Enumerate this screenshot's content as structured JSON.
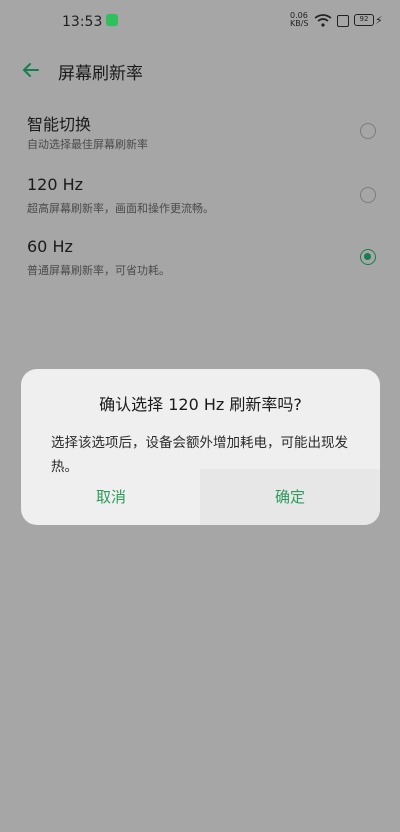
{
  "status_bar": {
    "time": "13:53",
    "net_speed": "0.06 KB/S",
    "battery": "92"
  },
  "header": {
    "title": "屏幕刷新率"
  },
  "options": [
    {
      "label": "智能切换",
      "desc": "自动选择最佳屏幕刷新率",
      "selected": false
    },
    {
      "label": "120 Hz",
      "desc": "超高屏幕刷新率，画面和操作更流畅。",
      "selected": false
    },
    {
      "label": "60 Hz",
      "desc": "普通屏幕刷新率，可省功耗。",
      "selected": true
    }
  ],
  "dialog": {
    "title": "确认选择 120 Hz 刷新率吗?",
    "message": "选择该选项后，设备会额外增加耗电，可能出现发热。",
    "cancel_label": "取消",
    "confirm_label": "确定"
  },
  "colors": {
    "accent": "#177d4f",
    "dialog_button": "#2e9a5e",
    "scrim": "#a6a6a6"
  }
}
